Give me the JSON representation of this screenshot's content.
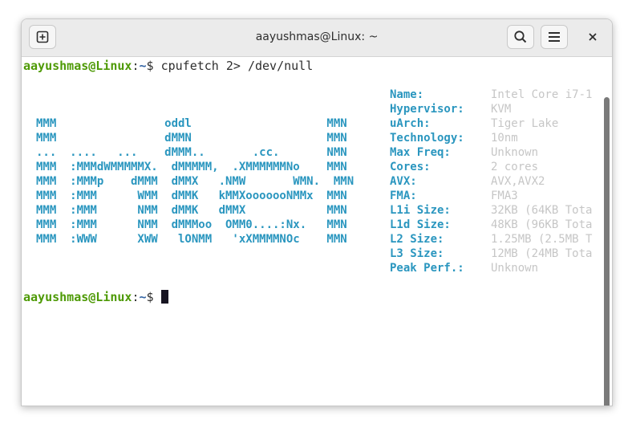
{
  "window": {
    "title": "aayushmas@Linux: ~"
  },
  "prompt": {
    "user_host": "aayushmas@Linux",
    "separator": ":",
    "path": "~",
    "symbol": "$ "
  },
  "command": "cpufetch 2> /dev/null",
  "ascii_logo": [
    "",
    "",
    "MMM                oddl                    MMN",
    "MMM                dMMN                    MMN",
    "...  ....   ...    dMMM..       .cc.       NMN",
    "MMM  :MMMdWMMMMMX.  dMMMMM,  .XMMMMMMNo    MMN",
    "MMM  :MMMp    dMMM  dMMX   .NMW       WMN.  MMN",
    "MMM  :MMM      WMM  dMMK   kMMXooooooNMMx  MMN",
    "MMM  :MMM      NMM  dMMK   dMMX            MMN",
    "MMM  :MMM      NMM  dMMMoo  OMM0....:Nx.   MMN",
    "MMM  :WWW      XWW   lONMM   'xXMMMMNOc    MMN"
  ],
  "cpu_info": [
    {
      "label": "Name:",
      "value": "Intel Core i7-1"
    },
    {
      "label": "Hypervisor:",
      "value": "KVM"
    },
    {
      "label": "uArch:",
      "value": "Tiger Lake"
    },
    {
      "label": "Technology:",
      "value": "10nm"
    },
    {
      "label": "Max Freq:",
      "value": "Unknown"
    },
    {
      "label": "Cores:",
      "value": "2 cores"
    },
    {
      "label": "AVX:",
      "value": "AVX,AVX2"
    },
    {
      "label": "FMA:",
      "value": "FMA3"
    },
    {
      "label": "L1i Size:",
      "value": "32KB (64KB Tota"
    },
    {
      "label": "L1d Size:",
      "value": "48KB (96KB Tota"
    },
    {
      "label": "L2 Size:",
      "value": "1.25MB (2.5MB T"
    },
    {
      "label": "L3 Size:",
      "value": "12MB (24MB Tota"
    },
    {
      "label": "Peak Perf.:",
      "value": "Unknown"
    }
  ],
  "colors": {
    "prompt_user": "#4e9a06",
    "prompt_path": "#3465a4",
    "logo": "#2a96bf",
    "info_value": "#c6c6c6"
  },
  "icons": {
    "new_tab": "new-tab-icon",
    "search": "search-icon",
    "menu": "hamburger-menu-icon",
    "close": "close-icon"
  }
}
